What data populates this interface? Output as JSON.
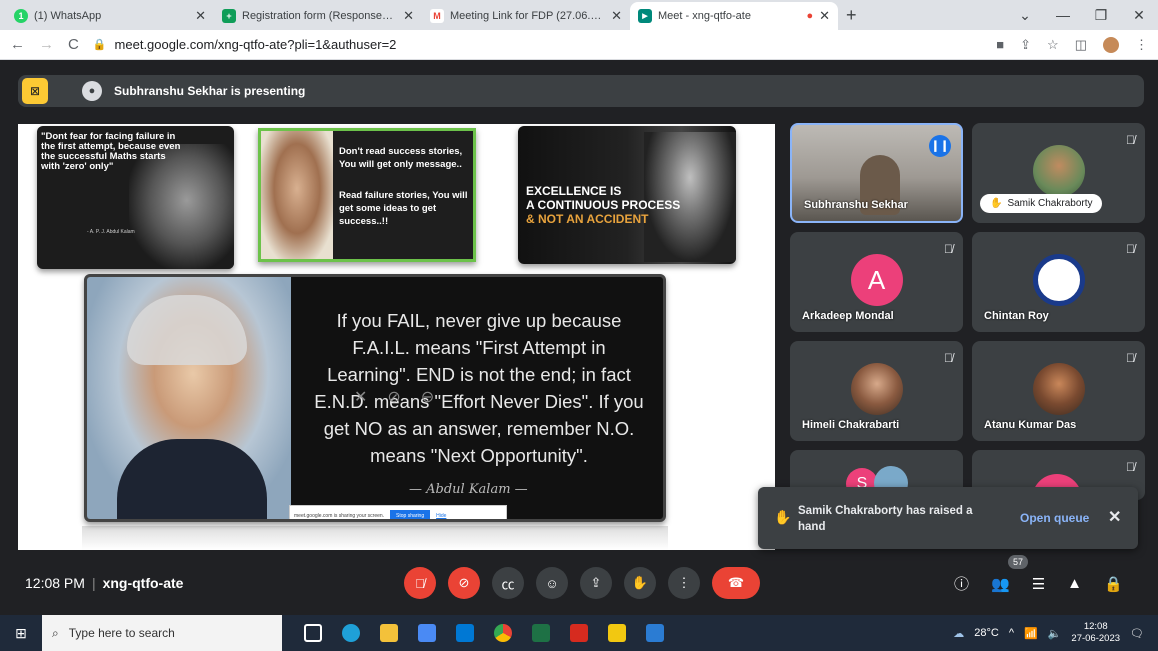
{
  "browser": {
    "tabs": [
      {
        "title": "(1) WhatsApp",
        "color": "#25d366",
        "glyph": "1"
      },
      {
        "title": "Registration form (Responses) - G",
        "color": "#0f9d58",
        "glyph": "+"
      },
      {
        "title": "Meeting Link for FDP (27.06.23 to",
        "color": "#ea4335",
        "glyph": "M"
      },
      {
        "title": "Meet - xng-qtfo-ate",
        "color": "#00897b",
        "glyph": "▶"
      }
    ],
    "url": "meet.google.com/xng-qtfo-ate?pli=1&authuser=2"
  },
  "presentation": {
    "presenter_text": "Subhranshu Sekhar is presenting",
    "slide1_text": "\"Dont fear for facing failure in the first attempt, because even the successful Maths starts with 'zero' only\"",
    "slide1_sig": "- A. P. J. Abdul Kalam",
    "slide2_line1": "Don't read success stories, You will get only message..",
    "slide2_line2": "Read failure stories, You will get some ideas to get success..!!",
    "slide3_line1": "EXCELLENCE IS",
    "slide3_line2": "A CONTINUOUS PROCESS",
    "slide3_line3": "& NOT AN ACCIDENT",
    "main_quote": "If you FAIL, never give up because F.A.I.L. means \"First Attempt in Learning\". END is not the end; in fact E.N.D. means \"Effort Never Dies\". If you get NO as an answer, remember N.O. means \"Next Opportunity\".",
    "main_sig": "— Abdul Kalam —",
    "share_text": "meet.google.com is sharing your screen.",
    "stop_sharing": "Stop sharing",
    "hide": "Hide"
  },
  "participants": [
    {
      "name": "Subhranshu Sekhar"
    },
    {
      "name": "Samik Chakraborty"
    },
    {
      "name": "Arkadeep Mondal",
      "initial": "A",
      "color": "#ec407a"
    },
    {
      "name": "Chintan Roy"
    },
    {
      "name": "Himeli Chakrabarti"
    },
    {
      "name": "Atanu Kumar Das"
    },
    {
      "initial": "S",
      "color": "#ec407a"
    }
  ],
  "toast": {
    "message": "Samik Chakraborty has raised a hand",
    "action": "Open queue"
  },
  "meeting": {
    "time": "12:08 PM",
    "code": "xng-qtfo-ate",
    "participant_count": "57"
  },
  "taskbar": {
    "search_placeholder": "Type here to search",
    "weather": "28°C",
    "time": "12:08",
    "date": "27-06-2023"
  }
}
